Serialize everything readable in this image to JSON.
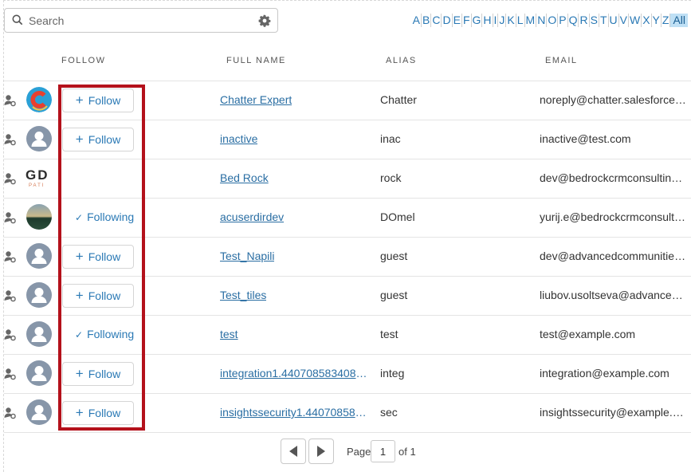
{
  "search": {
    "placeholder": "Search"
  },
  "alphabet": [
    "A",
    "B",
    "C",
    "D",
    "E",
    "F",
    "G",
    "H",
    "I",
    "J",
    "K",
    "L",
    "M",
    "N",
    "O",
    "P",
    "Q",
    "R",
    "S",
    "T",
    "U",
    "V",
    "W",
    "X",
    "Y",
    "Z",
    "All"
  ],
  "alphabet_active": "All",
  "columns": {
    "follow": "FOLLOW",
    "full_name": "FULL NAME",
    "alias": "ALIAS",
    "email": "EMAIL"
  },
  "labels": {
    "follow": "Follow",
    "following": "Following"
  },
  "rows": [
    {
      "avatar": "chatter-logo",
      "follow_state": "follow",
      "name": "Chatter Expert",
      "alias": "Chatter",
      "email": "noreply@chatter.salesforce.com"
    },
    {
      "avatar": "person",
      "follow_state": "follow",
      "name": "inactive",
      "alias": "inac",
      "email": "inactive@test.com"
    },
    {
      "avatar": "gd-logo",
      "logo_text": "GD",
      "logo_sub": "PATI",
      "follow_state": "none",
      "name": "Bed Rock",
      "alias": "rock",
      "email": "dev@bedrockcrmconsulting.co..."
    },
    {
      "avatar": "landscape",
      "follow_state": "following",
      "name": "acuserdirdev",
      "alias": "DOmel",
      "email": "yurij.e@bedrockcrmconsulting..."
    },
    {
      "avatar": "person",
      "follow_state": "follow",
      "name": "Test_Napili",
      "alias": "guest",
      "email": "dev@advancedcommunities.c..."
    },
    {
      "avatar": "person",
      "follow_state": "follow",
      "name": "Test_tiles",
      "alias": "guest",
      "email": "liubov.usoltseva@advancedco..."
    },
    {
      "avatar": "person",
      "follow_state": "following",
      "name": "test",
      "alias": "test",
      "email": "test@example.com"
    },
    {
      "avatar": "person",
      "follow_state": "follow",
      "name": "integration1.4407085834085...",
      "alias": "integ",
      "email": "integration@example.com"
    },
    {
      "avatar": "person",
      "follow_state": "follow",
      "name": "insightssecurity1.440708584...",
      "alias": "sec",
      "email": "insightssecurity@example.com"
    }
  ],
  "pager": {
    "page_label": "Page",
    "page_value": "1",
    "of_label": "of 1"
  },
  "colors": {
    "link": "#2a79b5",
    "highlight_box": "#b4111b",
    "avatar_bg": "#8796a9",
    "alpha_active_bg": "#bfe0f5"
  }
}
